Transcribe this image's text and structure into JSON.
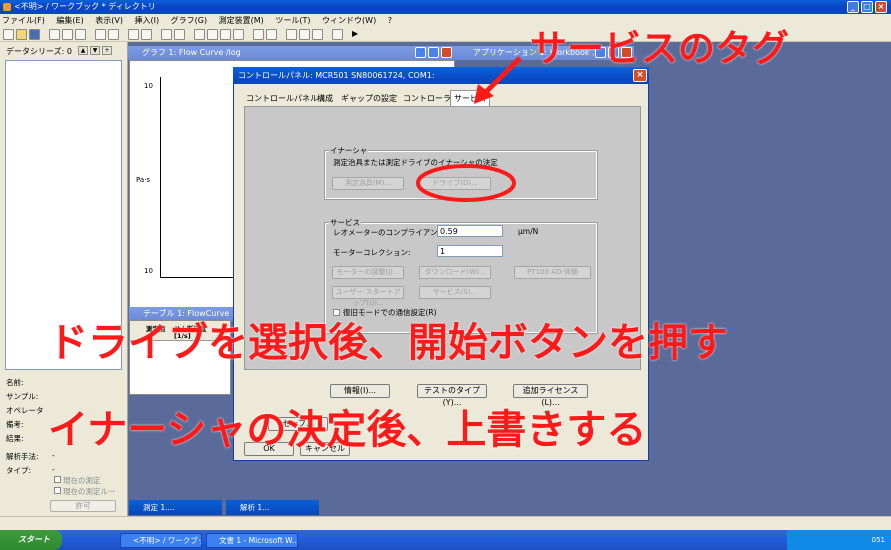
{
  "app": {
    "title": "<不明> / ワークブック * ディレクトリ",
    "menu": [
      "ファイル(F)",
      "編集(E)",
      "表示(V)",
      "挿入(I)",
      "グラフ(G)",
      "測定装置(M)",
      "ツール(T)",
      "ウィンドウ(W)",
      "?"
    ]
  },
  "left_panel": {
    "series_label": "データシリーズ: 0",
    "info": [
      "名前:",
      "サンプル:",
      "オペレータ",
      "備考:",
      "結果:"
    ],
    "analysis_label": "解析手法:",
    "analysis_value": "-",
    "type_label": "タイプ:",
    "type_value": "-",
    "checkbox_current": "現在の測定",
    "checkbox_current_ruler": "現在の測定ルー",
    "permit_button": "許可"
  },
  "windows": {
    "graph_title": "グラフ 1: Flow Curve  /log",
    "graph_axis_top": "10",
    "graph_axis_bottom": "10",
    "graph_axis_unit": "Pa·s",
    "app_window_title": "アプリケーション 1: Workbook ...",
    "table_title": "テーブル 1: FlowCurve ...",
    "table_header_1": "測定点",
    "table_header_2": "せん断速度",
    "table_header_unit": "[1/s]",
    "min_measure": "測定 1....",
    "min_analysis": "解析 1..."
  },
  "dialog": {
    "title": "コントロールパネル: MCR501 SN80061724, COM1:",
    "tabs": [
      "コントロールパネル",
      "構成",
      "ギャップの設定",
      "コントローラー",
      "サービス"
    ],
    "selected_tab": "サービス",
    "inertia_group": "イナーシャ",
    "inertia_desc": "測定治具または測定ドライブのイナーシャの決定",
    "btn_fixture": "測定治具(M)...",
    "btn_drive": "ドライブ(D)...",
    "service_group": "サービス",
    "compliance_label": "レオメーターのコンプライアンス(C):",
    "compliance_value": "0.59",
    "compliance_unit": "μm/N",
    "motor_label": "モーターコレクション:",
    "motor_value": "1",
    "btn_motor_adjust": "モーターの調整(J)...",
    "btn_download": "ダウンロード(W)...",
    "btn_pt100": "PT100 AD-体験",
    "btn_user_start": "ユーザー スタートアップ(U)...",
    "btn_service": "サービス(S)...",
    "restore_checkbox": "復旧モードでの通信設定(R)",
    "btn_info": "情報(I)...",
    "btn_test_type": "テストのタイプ(Y)...",
    "btn_add_license": "追加ライセンス(L)...",
    "btn_ok": "OK",
    "btn_cancel": "キャンセル",
    "btn_save": "セーブ..."
  },
  "annotations": {
    "service_tag": "サービスのタグ",
    "drive_select": "ドライブを選択後、開始ボタンを押す",
    "inertia_overwrite": "イナーシャの決定後、上書きする",
    "color": "#ff1a1a"
  },
  "taskbar": {
    "start": "スタート",
    "tasks": [
      "<不明> / ワークブック...",
      "文書 1 - Microsoft W..."
    ],
    "clock": "051"
  }
}
